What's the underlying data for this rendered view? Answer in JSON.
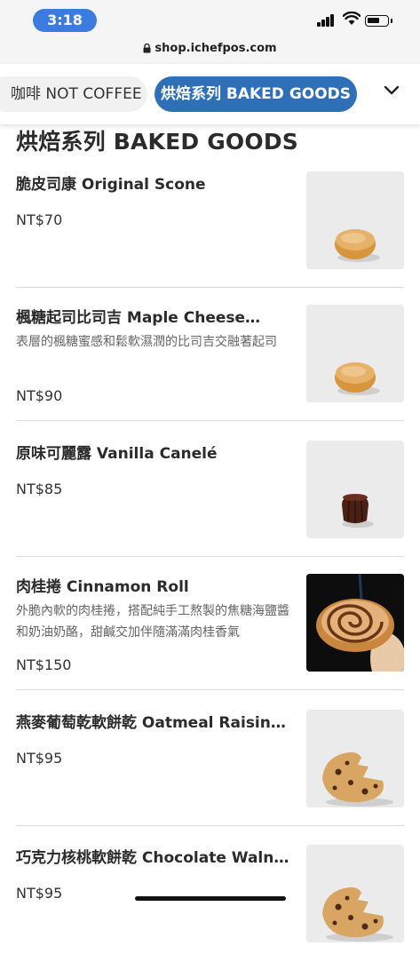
{
  "status_bar": {
    "time": "3:18"
  },
  "browser": {
    "url": "shop.ichefpos.com"
  },
  "tabs": [
    {
      "label": "咖啡 NOT COFFEE"
    },
    {
      "label": "烘焙系列 BAKED GOODS"
    }
  ],
  "section": {
    "title": "烘焙系列 BAKED GOODS"
  },
  "items": [
    {
      "name": "脆皮司康 Original Scone",
      "desc": "",
      "price": "NT$70",
      "image": "scone"
    },
    {
      "name": "楓糖起司比司吉 Maple Cheese…",
      "desc": "表層的楓糖蜜感和鬆軟濕潤的比司吉交融著起司",
      "price": "NT$90",
      "image": "scone"
    },
    {
      "name": "原味可麗露 Vanilla Canelé",
      "desc": "",
      "price": "NT$85",
      "image": "canele"
    },
    {
      "name": "肉桂捲 Cinnamon Roll",
      "desc": "外脆內軟的肉桂捲，搭配純手工熬製的焦糖海鹽醬和奶油奶酪，甜鹹交加伴隨滿滿肉桂香氣",
      "price": "NT$150",
      "image": "cinnamon-roll"
    },
    {
      "name": "燕麥葡萄乾軟餅乾 Oatmeal Raisin…",
      "desc": "",
      "price": "NT$95",
      "image": "cookie"
    },
    {
      "name": "巧克力核桃軟餅乾 Chocolate Waln…",
      "desc": "",
      "price": "NT$95",
      "image": "cookie"
    }
  ]
}
